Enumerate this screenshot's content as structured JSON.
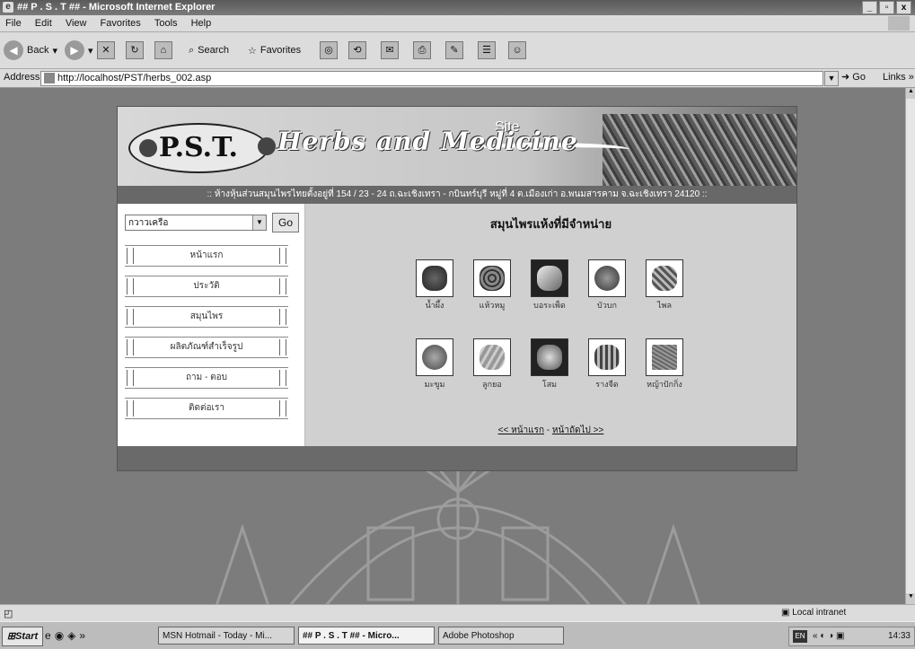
{
  "window": {
    "title": "## P . S . T ## - Microsoft Internet Explorer",
    "minimize": "_",
    "maximize": "▫",
    "close": "x"
  },
  "menu": [
    "File",
    "Edit",
    "View",
    "Favorites",
    "Tools",
    "Help"
  ],
  "toolbar": {
    "back": "Back",
    "search": "Search",
    "favorites": "Favorites"
  },
  "address": {
    "label": "Address",
    "url": "http://localhost/PST/herbs_002.asp",
    "go": "Go",
    "links": "Links"
  },
  "site": {
    "logo": "P.S.T.",
    "tagline": "Herbs and Medicine",
    "site_word": "Site",
    "address_line": ":: ห้างหุ้นส่วนสมุนไพรไทยตั้งอยู่ที่ 154 / 23 - 24 ถ.ฉะเชิงเทรา - กบินทร์บุรี หมู่ที่ 4 ต.เมืองเก่า อ.พนมสารคาม จ.ฉะเชิงเทรา 24120 ::",
    "select_value": "กวาวเครือ",
    "select_go": "Go",
    "nav": [
      "หน้าแรก",
      "ประวัติ",
      "สมุนไพร",
      "ผลิตภัณฑ์สำเร็จรูป",
      "ถาม - ตอบ",
      "ติดต่อเรา"
    ],
    "main_title": "สมุนไพรแห้งที่มีจำหน่าย",
    "herbs_row1": [
      "น้ำผึ้ง",
      "แห้วหมู",
      "บอระเพ็ด",
      "บัวบก",
      "ไพล"
    ],
    "herbs_row2": [
      "มะขูม",
      "ลูกยอ",
      "โสม",
      "รางจืด",
      "หญ้าปักกิ่ง"
    ],
    "pager_prev": "<< หน้าแรก",
    "pager_sep": "-",
    "pager_next": "หน้าถัดไป >>"
  },
  "status": {
    "zone": "Local intranet"
  },
  "taskbar": {
    "start": "Start",
    "tasks": [
      "MSN Hotmail - Today - Mi...",
      "## P . S . T ## - Micro...",
      "Adobe Photoshop"
    ],
    "lang": "EN",
    "clock": "14:33"
  }
}
